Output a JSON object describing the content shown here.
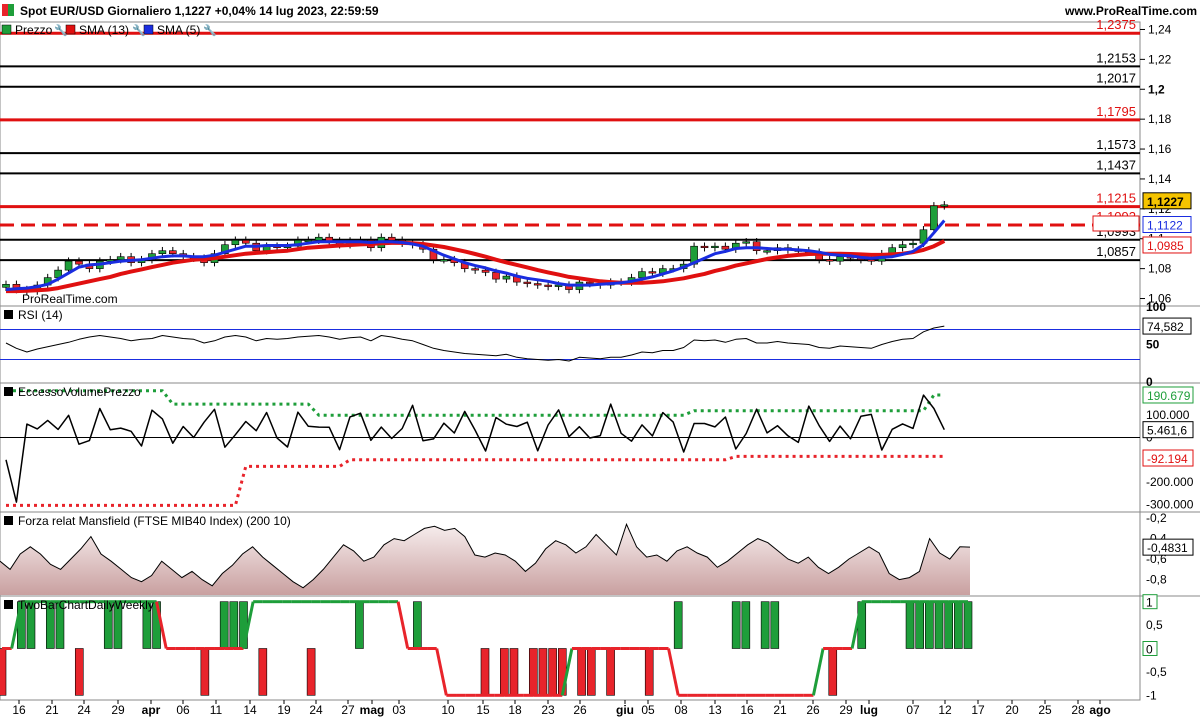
{
  "header": {
    "title": "Spot EUR/USD Giornaliero 1,1227 +0,04% 14 lug 2023, 22:59:59",
    "site": "www.ProRealTime.com",
    "watermark": "ProRealTime.com"
  },
  "colors": {
    "up": "#1e9e3a",
    "down": "#e8242b",
    "sma13": "#e01010",
    "sma5": "#1a2de0",
    "resistance_red": "#e01010",
    "fill_mansfield": "#d9bdbd",
    "label_gold": "#f5c400"
  },
  "chart_data": [
    {
      "type": "candlestick",
      "name": "Prezzo",
      "legend": [
        {
          "label": "Prezzo",
          "color": "#1e9e3a"
        },
        {
          "label": "SMA (13)",
          "color": "#e01010"
        },
        {
          "label": "SMA (5)",
          "color": "#1a2de0"
        }
      ],
      "ylim": [
        1.055,
        1.245
      ],
      "y_ticks": [
        1.24,
        1.22,
        1.2,
        1.18,
        1.16,
        1.14,
        1.12,
        1.1,
        1.08,
        1.06
      ],
      "y_tick_labels": [
        "1,24",
        "1,22",
        "1,2",
        "1,18",
        "1,16",
        "1,14",
        "1,12",
        "1,1",
        "1,08",
        "1,06"
      ],
      "x_labels": [
        "16",
        "21",
        "24",
        "29",
        "apr",
        "06",
        "11",
        "14",
        "19",
        "24",
        "27",
        "mag",
        "03",
        "10",
        "15",
        "18",
        "23",
        "26",
        "giu",
        "05",
        "08",
        "13",
        "16",
        "21",
        "26",
        "29",
        "lug",
        "07",
        "12",
        "17",
        "20",
        "25",
        "28",
        "ago"
      ],
      "closes": [
        1.0695,
        1.066,
        1.065,
        1.069,
        1.074,
        1.079,
        1.085,
        1.083,
        1.08,
        1.085,
        1.086,
        1.088,
        1.084,
        1.086,
        1.09,
        1.092,
        1.09,
        1.088,
        1.087,
        1.084,
        1.09,
        1.096,
        1.099,
        1.097,
        1.092,
        1.095,
        1.094,
        1.095,
        1.099,
        1.099,
        1.101,
        1.0985,
        1.096,
        1.0985,
        1.099,
        1.094,
        1.101,
        1.099,
        1.097,
        1.096,
        1.093,
        1.086,
        1.086,
        1.084,
        1.08,
        1.079,
        1.0775,
        1.073,
        1.075,
        1.071,
        1.07,
        1.069,
        1.068,
        1.069,
        1.066,
        1.071,
        1.07,
        1.069,
        1.071,
        1.071,
        1.074,
        1.078,
        1.077,
        1.08,
        1.08,
        1.083,
        1.095,
        1.094,
        1.095,
        1.093,
        1.097,
        1.098,
        1.092,
        1.092,
        1.094,
        1.0925,
        1.092,
        1.091,
        1.086,
        1.085,
        1.088,
        1.0875,
        1.086,
        1.085,
        1.09,
        1.094,
        1.096,
        1.097,
        1.106,
        1.122,
        1.1227
      ],
      "sma5": [
        1.066,
        1.0665,
        1.067,
        1.068,
        1.0695,
        1.073,
        1.077,
        1.081,
        1.0825,
        1.083,
        1.084,
        1.085,
        1.0855,
        1.086,
        1.087,
        1.088,
        1.0885,
        1.0885,
        1.088,
        1.088,
        1.089,
        1.091,
        1.093,
        1.095,
        1.095,
        1.0955,
        1.0955,
        1.0955,
        1.096,
        1.097,
        1.098,
        1.098,
        1.098,
        1.098,
        1.098,
        1.0975,
        1.098,
        1.098,
        1.0975,
        1.0965,
        1.095,
        1.092,
        1.089,
        1.0865,
        1.084,
        1.082,
        1.0805,
        1.0785,
        1.077,
        1.075,
        1.0735,
        1.0725,
        1.0715,
        1.07,
        1.069,
        1.069,
        1.069,
        1.0695,
        1.07,
        1.0705,
        1.0715,
        1.073,
        1.0745,
        1.0765,
        1.0785,
        1.081,
        1.084,
        1.087,
        1.09,
        1.0915,
        1.0935,
        1.094,
        1.094,
        1.0935,
        1.093,
        1.093,
        1.0925,
        1.092,
        1.091,
        1.0895,
        1.089,
        1.0885,
        1.0875,
        1.087,
        1.0875,
        1.088,
        1.0895,
        1.0915,
        1.096,
        1.104,
        1.1122
      ],
      "sma13": [
        1.065,
        1.065,
        1.0652,
        1.0655,
        1.066,
        1.067,
        1.0685,
        1.07,
        1.0715,
        1.073,
        1.0745,
        1.0765,
        1.078,
        1.0795,
        1.081,
        1.0825,
        1.084,
        1.085,
        1.086,
        1.0865,
        1.087,
        1.088,
        1.089,
        1.09,
        1.0905,
        1.091,
        1.0915,
        1.092,
        1.093,
        1.094,
        1.0945,
        1.095,
        1.0955,
        1.0958,
        1.0962,
        1.0965,
        1.097,
        1.0972,
        1.0972,
        1.097,
        1.0965,
        1.0955,
        1.0945,
        1.093,
        1.0915,
        1.0898,
        1.088,
        1.086,
        1.0842,
        1.0825,
        1.0808,
        1.079,
        1.0775,
        1.076,
        1.0745,
        1.0735,
        1.0725,
        1.0715,
        1.071,
        1.0705,
        1.0705,
        1.0705,
        1.071,
        1.0715,
        1.0725,
        1.0735,
        1.075,
        1.0765,
        1.0785,
        1.08,
        1.082,
        1.0835,
        1.085,
        1.0865,
        1.0875,
        1.0885,
        1.0892,
        1.0898,
        1.09,
        1.09,
        1.09,
        1.0898,
        1.0895,
        1.0892,
        1.0892,
        1.0895,
        1.09,
        1.091,
        1.0925,
        1.095,
        1.0985
      ],
      "levels": [
        {
          "value": 1.2375,
          "label": "1,2375",
          "color": "#e01010",
          "style": "solid"
        },
        {
          "value": 1.2153,
          "label": "1,2153",
          "color": "#000000",
          "style": "solid"
        },
        {
          "value": 1.2017,
          "label": "1,2017",
          "color": "#000000",
          "style": "solid"
        },
        {
          "value": 1.1795,
          "label": "1,1795",
          "color": "#e01010",
          "style": "solid"
        },
        {
          "value": 1.1573,
          "label": "1,1573",
          "color": "#000000",
          "style": "solid"
        },
        {
          "value": 1.1437,
          "label": "1,1437",
          "color": "#000000",
          "style": "solid"
        },
        {
          "value": 1.1215,
          "label": "1,1215",
          "color": "#e01010",
          "style": "solid"
        },
        {
          "value": 1.1092,
          "label": "1,1092",
          "color": "#e01010",
          "style": "dashed"
        },
        {
          "value": 1.0993,
          "label": "1,0993",
          "color": "#000000",
          "style": "solid"
        },
        {
          "value": 1.0857,
          "label": "1,0857",
          "color": "#000000",
          "style": "solid"
        }
      ],
      "last_values": [
        {
          "label": "1,1227",
          "value": 1.1227,
          "style": "gold"
        },
        {
          "label": "1,1122",
          "value": 1.1122,
          "style": "blue"
        },
        {
          "label": "1,0985",
          "value": 1.0985,
          "style": "red"
        }
      ]
    },
    {
      "type": "line",
      "name": "RSI (14)",
      "ylim": [
        0,
        100
      ],
      "y_ticks": [
        100,
        50,
        0
      ],
      "y_tick_labels": [
        "100",
        "50",
        "0"
      ],
      "levels": [
        70,
        30
      ],
      "last_label": "74,582",
      "values": [
        52,
        45,
        40,
        44,
        47,
        50,
        53,
        57,
        60,
        62,
        60,
        58,
        55,
        57,
        58,
        62,
        60,
        58,
        57,
        52,
        55,
        60,
        62,
        60,
        55,
        58,
        57,
        58,
        60,
        61,
        62,
        60,
        57,
        59,
        60,
        55,
        62,
        60,
        57,
        55,
        50,
        45,
        42,
        40,
        38,
        37,
        36,
        35,
        37,
        33,
        31,
        30,
        29,
        30,
        28,
        33,
        32,
        31,
        33,
        33,
        36,
        40,
        39,
        42,
        42,
        46,
        56,
        55,
        56,
        53,
        57,
        58,
        52,
        52,
        54,
        52,
        51,
        50,
        46,
        45,
        48,
        47,
        46,
        45,
        50,
        54,
        57,
        58,
        67,
        72,
        74.582
      ]
    },
    {
      "type": "line",
      "name": "EccessoVolumePrezzo",
      "ylim": [
        -330000,
        240000
      ],
      "y_ticks": [
        100000,
        0,
        -200000,
        -300000
      ],
      "y_tick_labels": [
        "100.000",
        "0",
        "-200.000",
        "-300.000"
      ],
      "last_labels": [
        {
          "label": "190.679",
          "value": 190679,
          "color": "#1e9e3a"
        },
        {
          "label": "5.461,6",
          "value": 35000,
          "color": "#000000"
        },
        {
          "label": "-92.194",
          "value": -92194,
          "color": "#e01010"
        }
      ],
      "upper_band": [
        210000,
        210000,
        210000,
        210000,
        210000,
        210000,
        210000,
        210000,
        210000,
        210000,
        210000,
        210000,
        210000,
        210000,
        210000,
        210000,
        210000,
        210000,
        210000,
        210000,
        210000,
        210000,
        210000,
        210000,
        210000,
        210000,
        210000,
        210000,
        210000,
        210000,
        210000,
        210000,
        210000,
        210000,
        210000,
        210000,
        210000,
        210000,
        210000,
        210000,
        210000,
        210000,
        210000,
        210000,
        210000,
        210000,
        210000,
        210000,
        210000,
        210000,
        210000,
        210000,
        210000,
        210000,
        210000,
        210000,
        210000,
        210000,
        210000,
        210000,
        210000,
        210000,
        210000,
        210000,
        210000,
        210000,
        210000,
        210000,
        210000,
        210000,
        210000,
        210000,
        210000,
        210000,
        210000,
        210000,
        210000,
        210000,
        210000,
        210000,
        210000,
        210000,
        210000,
        210000,
        210000,
        210000,
        210000,
        210000,
        210000,
        210000,
        210000
      ],
      "lower_band": [
        0
      ],
      "values": [
        0
      ]
    },
    {
      "type": "area",
      "name": "Forza relat Mansfield (FTSE MIB40 Index) (200 10)",
      "ylim": [
        -0.95,
        -0.15
      ],
      "y_ticks": [
        -0.2,
        -0.4,
        -0.6,
        -0.8
      ],
      "y_tick_labels": [
        "-0,2",
        "-0,4",
        "-0,6",
        "-0,8"
      ],
      "last_label": "-0,4831",
      "values": [
        -0.62,
        -0.7,
        -0.55,
        -0.48,
        -0.55,
        -0.65,
        -0.7,
        -0.6,
        -0.5,
        -0.38,
        -0.55,
        -0.62,
        -0.7,
        -0.78,
        -0.82,
        -0.76,
        -0.62,
        -0.7,
        -0.78,
        -0.72,
        -0.8,
        -0.86,
        -0.74,
        -0.66,
        -0.55,
        -0.48,
        -0.58,
        -0.66,
        -0.74,
        -0.82,
        -0.88,
        -0.8,
        -0.7,
        -0.58,
        -0.46,
        -0.52,
        -0.62,
        -0.58,
        -0.46,
        -0.4,
        -0.42,
        -0.36,
        -0.3,
        -0.28,
        -0.32,
        -0.3,
        -0.38,
        -0.56,
        -0.58,
        -0.54,
        -0.56,
        -0.62,
        -0.72,
        -0.64,
        -0.5,
        -0.42,
        -0.46,
        -0.54,
        -0.48,
        -0.36,
        -0.46,
        -0.56,
        -0.26,
        -0.48,
        -0.58,
        -0.56,
        -0.62,
        -0.52,
        -0.48,
        -0.54,
        -0.58,
        -0.68,
        -0.62,
        -0.54,
        -0.46,
        -0.4,
        -0.44,
        -0.52,
        -0.6,
        -0.64,
        -0.58,
        -0.68,
        -0.74,
        -0.68,
        -0.6,
        -0.54,
        -0.48,
        -0.54,
        -0.74,
        -0.8,
        -0.78,
        -0.72,
        -0.4,
        -0.54,
        -0.6,
        -0.48,
        -0.4831
      ]
    },
    {
      "type": "bar",
      "name": "TwoBarChartDailyWeekly",
      "ylim": [
        -1.1,
        1.1
      ],
      "y_ticks": [
        1,
        0.5,
        0,
        -0.5,
        -1
      ],
      "y_tick_labels": [
        "1",
        "0,5",
        "0",
        "-0,5",
        "-1"
      ],
      "last_labels": [
        {
          "label": "1",
          "value": 1,
          "color": "#1e9e3a"
        },
        {
          "label": "0",
          "value": 0,
          "color": "#1e9e3a"
        }
      ],
      "daily": [
        -1,
        0,
        1,
        1,
        0,
        1,
        1,
        0,
        -1,
        0,
        0,
        1,
        1,
        0,
        0,
        1,
        1,
        0,
        0,
        0,
        0,
        -1,
        0,
        1,
        1,
        1,
        0,
        -1,
        0,
        0,
        0,
        0,
        -1,
        0,
        0,
        0,
        0,
        1,
        0,
        0,
        0,
        0,
        0,
        1,
        0,
        0,
        0,
        0,
        0,
        0,
        -1,
        0,
        -1,
        -1,
        0,
        -1,
        -1,
        -1,
        -1,
        0,
        -1,
        -1,
        0,
        -1,
        0,
        0,
        0,
        -1,
        0,
        0,
        1,
        0,
        0,
        0,
        0,
        0,
        1,
        1,
        0,
        1,
        1,
        0,
        0,
        0,
        0,
        0,
        -1,
        0,
        0,
        1,
        0,
        0,
        0,
        0,
        1,
        1,
        1,
        1,
        1,
        1,
        1
      ],
      "weekly": [
        0
      ]
    }
  ]
}
